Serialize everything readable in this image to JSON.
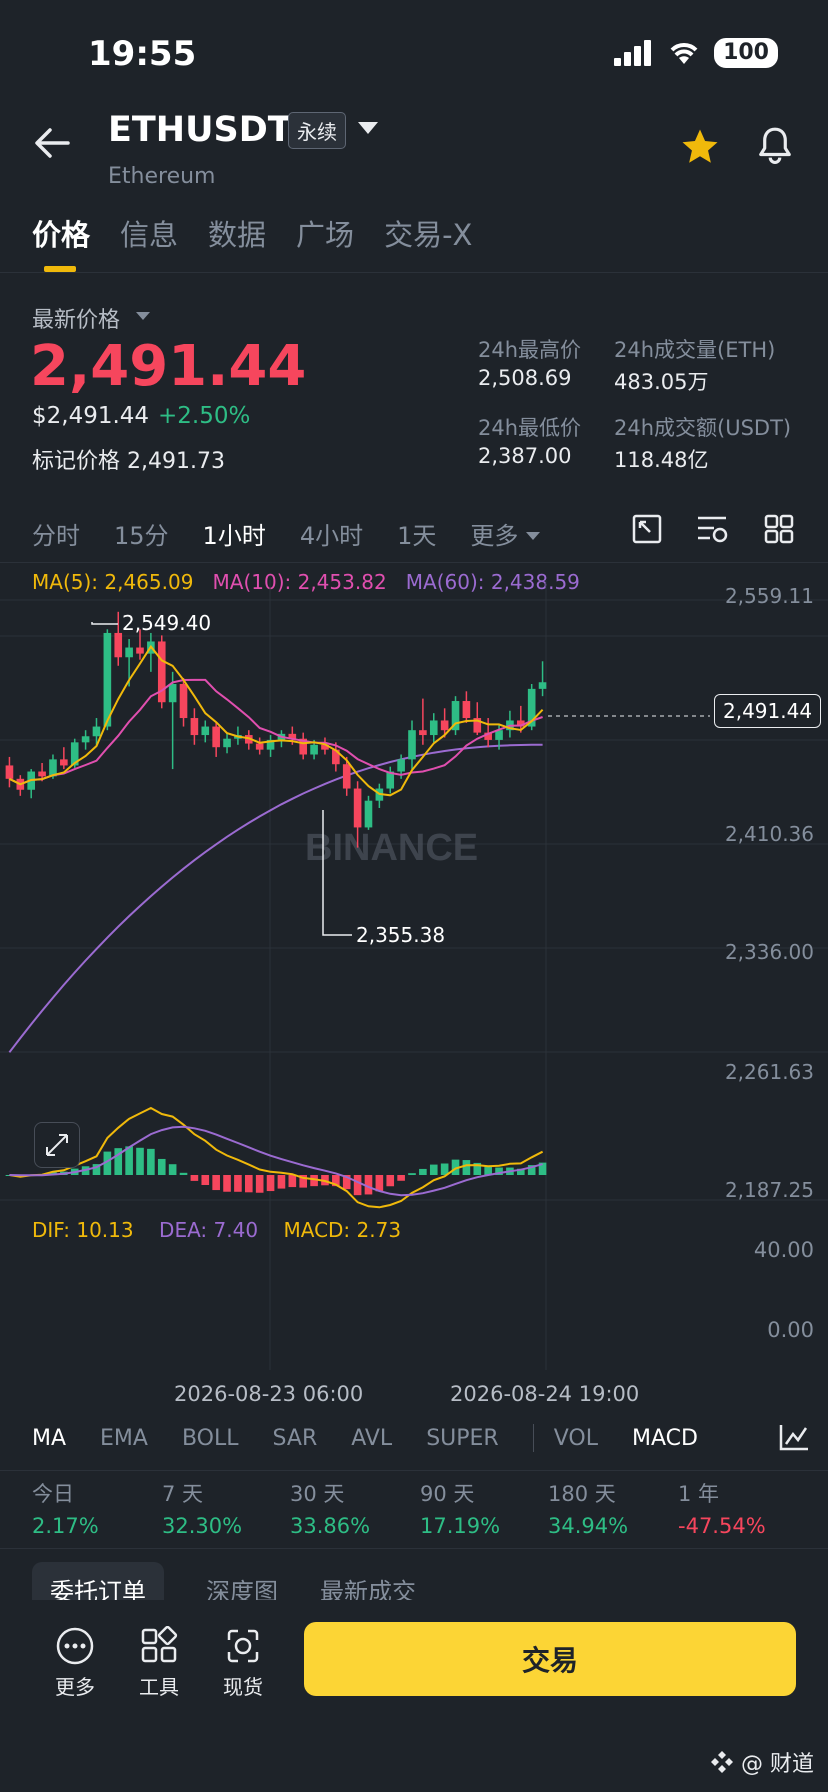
{
  "status": {
    "time": "19:55",
    "battery": "100"
  },
  "header": {
    "symbol": "ETHUSDT",
    "badge": "永续",
    "name": "Ethereum"
  },
  "tabs": [
    "价格",
    "信息",
    "数据",
    "广场",
    "交易-X"
  ],
  "price": {
    "latest_label": "最新价格",
    "last": "2,491.44",
    "usd": "$2,491.44",
    "change": "+2.50%",
    "mark_label": "标记价格",
    "mark": "2,491.73"
  },
  "stats": {
    "high_label": "24h最高价",
    "high": "2,508.69",
    "vol_label": "24h成交量(ETH)",
    "vol": "483.05万",
    "low_label": "24h最低价",
    "low": "2,387.00",
    "turnover_label": "24h成交额(USDT)",
    "turnover": "118.48亿"
  },
  "intervals": [
    "分时",
    "15分",
    "1小时",
    "4小时",
    "1天",
    "更多"
  ],
  "ma": {
    "ma5": "MA(5): 2,465.09",
    "ma10": "MA(10): 2,453.82",
    "ma60": "MA(60): 2,438.59"
  },
  "chart": {
    "price_axis": [
      "2,559.11",
      "2,410.36",
      "2,336.00",
      "2,261.63",
      "2,187.25"
    ],
    "current_tag": "2,491.44",
    "high_marker": "2,549.40",
    "low_marker": "2,355.38",
    "watermark": "BINANCE",
    "macd_axis": [
      "40.00",
      "0.00"
    ],
    "time_axis": [
      "2026-08-23 06:00",
      "2026-08-24 19:00"
    ]
  },
  "macd": {
    "dif": "DIF: 10.13",
    "dea": "DEA: 7.40",
    "macd": "MACD: 2.73"
  },
  "indicators": [
    "MA",
    "EMA",
    "BOLL",
    "SAR",
    "AVL",
    "SUPER",
    "VOL",
    "MACD"
  ],
  "performance": [
    {
      "label": "今日",
      "value": "2.17%"
    },
    {
      "label": "7 天",
      "value": "32.30%"
    },
    {
      "label": "30 天",
      "value": "33.86%"
    },
    {
      "label": "90 天",
      "value": "17.19%"
    },
    {
      "label": "180 天",
      "value": "34.94%"
    },
    {
      "label": "1 年",
      "value": "-47.54%"
    }
  ],
  "book_tabs": [
    "委托订单",
    "深度图",
    "最新成交"
  ],
  "nav": {
    "more": "更多",
    "tools": "工具",
    "spot": "现货",
    "trade": "交易"
  },
  "watermark_text": "@ 财道",
  "colors": {
    "up": "#2ebd85",
    "down": "#f6465d",
    "accent": "#f0b90b",
    "ma5": "#f0b90b",
    "ma10": "#e04faf",
    "ma60": "#9b6bd1"
  },
  "chart_data": {
    "type": "candlestick",
    "ylim": [
      2187.25,
      2559.11
    ],
    "candles": [
      [
        2423,
        2430,
        2405,
        2412
      ],
      [
        2412,
        2415,
        2398,
        2403
      ],
      [
        2403,
        2420,
        2396,
        2418
      ],
      [
        2418,
        2425,
        2410,
        2414
      ],
      [
        2414,
        2432,
        2412,
        2428
      ],
      [
        2428,
        2438,
        2420,
        2423
      ],
      [
        2423,
        2445,
        2421,
        2442
      ],
      [
        2442,
        2452,
        2436,
        2447
      ],
      [
        2447,
        2462,
        2440,
        2455
      ],
      [
        2455,
        2535,
        2452,
        2532
      ],
      [
        2532,
        2549.4,
        2505,
        2512
      ],
      [
        2512,
        2527,
        2488,
        2520
      ],
      [
        2520,
        2535,
        2510,
        2515
      ],
      [
        2515,
        2532,
        2500,
        2525
      ],
      [
        2525,
        2530,
        2470,
        2475
      ],
      [
        2475,
        2500,
        2420,
        2490
      ],
      [
        2490,
        2495,
        2455,
        2462
      ],
      [
        2462,
        2470,
        2440,
        2448
      ],
      [
        2448,
        2460,
        2442,
        2455
      ],
      [
        2455,
        2458,
        2430,
        2438
      ],
      [
        2438,
        2450,
        2433,
        2445
      ],
      [
        2445,
        2455,
        2440,
        2448
      ],
      [
        2448,
        2452,
        2436,
        2441
      ],
      [
        2441,
        2446,
        2432,
        2436
      ],
      [
        2436,
        2448,
        2430,
        2444
      ],
      [
        2444,
        2452,
        2438,
        2449
      ],
      [
        2449,
        2455,
        2440,
        2445
      ],
      [
        2445,
        2450,
        2428,
        2432
      ],
      [
        2432,
        2444,
        2428,
        2440
      ],
      [
        2440,
        2446,
        2432,
        2436
      ],
      [
        2436,
        2442,
        2418,
        2424
      ],
      [
        2424,
        2430,
        2398,
        2404
      ],
      [
        2404,
        2410,
        2355.38,
        2372
      ],
      [
        2372,
        2398,
        2370,
        2394
      ],
      [
        2394,
        2408,
        2388,
        2404
      ],
      [
        2404,
        2422,
        2400,
        2418
      ],
      [
        2418,
        2432,
        2412,
        2428
      ],
      [
        2428,
        2460,
        2420,
        2452
      ],
      [
        2452,
        2478,
        2440,
        2448
      ],
      [
        2448,
        2466,
        2442,
        2460
      ],
      [
        2460,
        2470,
        2446,
        2452
      ],
      [
        2452,
        2480,
        2448,
        2476
      ],
      [
        2476,
        2484,
        2458,
        2462
      ],
      [
        2462,
        2475,
        2448,
        2450
      ],
      [
        2450,
        2462,
        2438,
        2444
      ],
      [
        2444,
        2456,
        2436,
        2452
      ],
      [
        2452,
        2468,
        2446,
        2460
      ],
      [
        2460,
        2472,
        2450,
        2455
      ],
      [
        2455,
        2490,
        2452,
        2486
      ],
      [
        2486,
        2508.69,
        2480,
        2491.44
      ]
    ]
  }
}
